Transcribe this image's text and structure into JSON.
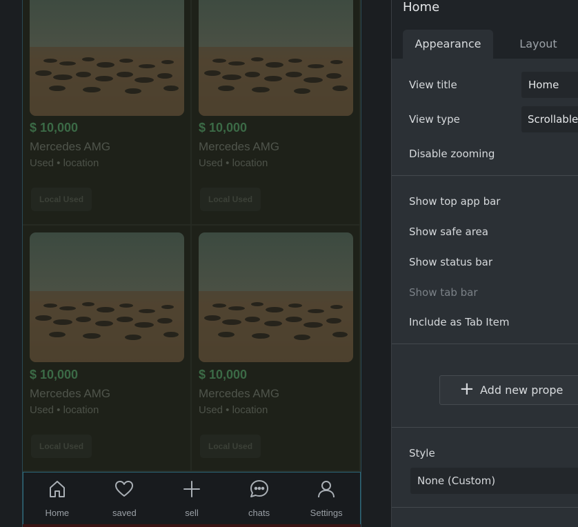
{
  "listings": [
    {
      "price": "$ 10,000",
      "title": "Mercedes AMG",
      "meta": "Used • location",
      "chip": "Local Used"
    },
    {
      "price": "$ 10,000",
      "title": "Mercedes AMG",
      "meta": "Used • location",
      "chip": "Local Used"
    },
    {
      "price": "$ 10,000",
      "title": "Mercedes AMG",
      "meta": "Used • location",
      "chip": "Local Used"
    },
    {
      "price": "$ 10,000",
      "title": "Mercedes AMG",
      "meta": "Used • location",
      "chip": "Local Used"
    }
  ],
  "tabbar": [
    {
      "label": "Home",
      "icon": "home-icon"
    },
    {
      "label": "saved",
      "icon": "heart-icon"
    },
    {
      "label": "sell",
      "icon": "plus-icon"
    },
    {
      "label": "chats",
      "icon": "chat-bubble-icon"
    },
    {
      "label": "Settings",
      "icon": "user-icon"
    }
  ],
  "panel": {
    "title": "Home",
    "tabs": [
      "Appearance",
      "Layout"
    ],
    "view_title_label": "View title",
    "view_title_value": "Home",
    "view_type_label": "View type",
    "view_type_value": "Scrollable",
    "disable_zoom_label": "Disable zooming",
    "show_top_app_bar": "Show top app bar",
    "show_safe_area": "Show safe area",
    "show_status_bar": "Show status bar",
    "show_tab_bar": "Show tab bar",
    "include_tab_item": "Include as Tab Item",
    "add_property": "Add new prope",
    "style_label": "Style",
    "style_value": "None (Custom)"
  },
  "colors": {
    "price": "#3b6a46",
    "accent_border": "#2c6778",
    "panel_bg": "#2b3035"
  }
}
